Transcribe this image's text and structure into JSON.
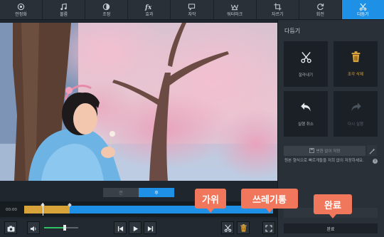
{
  "toolbar": {
    "items": [
      {
        "label": "안정화",
        "icon": "stabilize-icon"
      },
      {
        "label": "볼륨",
        "icon": "music-note-icon"
      },
      {
        "label": "조정",
        "icon": "adjust-icon"
      },
      {
        "label": "효과",
        "icon": "fx-icon"
      },
      {
        "label": "자막",
        "icon": "subtitle-icon"
      },
      {
        "label": "워터마크",
        "icon": "watermark-icon"
      },
      {
        "label": "자르기",
        "icon": "crop-icon"
      },
      {
        "label": "회전",
        "icon": "rotate-icon"
      },
      {
        "label": "다듬기",
        "icon": "scissors-icon",
        "active": true
      }
    ]
  },
  "timeline": {
    "segment_tabs": [
      "전",
      "후"
    ],
    "active_tab": "후",
    "time": "00:00"
  },
  "callouts": {
    "scissors": "가위",
    "trash": "쓰레기통",
    "done": "완료"
  },
  "panel": {
    "title": "다듬기",
    "cut_label": "잘라내기",
    "delete_label": "조각 삭제",
    "undo_label": "실행 취소",
    "redo_label": "다시 실행",
    "save_label": "변환 없이 저장",
    "note": "원본 형식으로 빠르게들을 저희 없이 저장하세요.",
    "help": "?",
    "done_label": "완료"
  },
  "colors": {
    "accent": "#1e90e6",
    "selection": "#d8a339",
    "callout": "#f0775b",
    "volume": "#31c267"
  },
  "volume_level": 0.6
}
